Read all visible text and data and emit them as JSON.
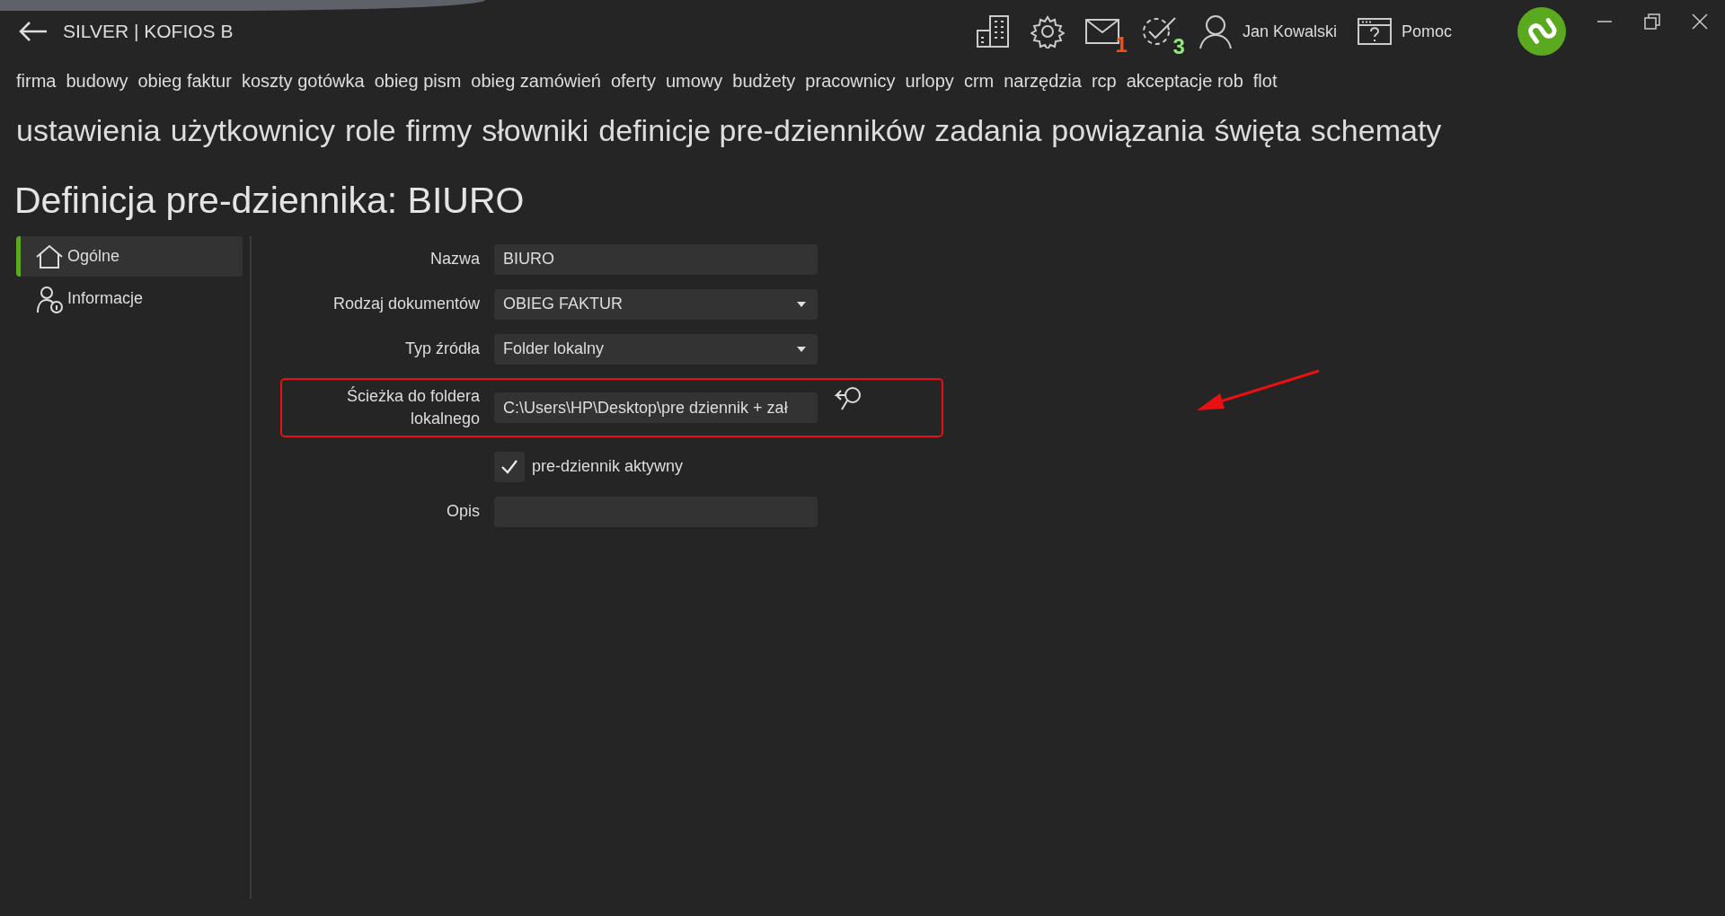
{
  "app_bar": {
    "title": "SILVER | KOFIOS B",
    "user_name": "Jan Kowalski",
    "help_label": "Pomoc",
    "mail_count": "1",
    "task_count": "3"
  },
  "main_menu": [
    "firma",
    "budowy",
    "obieg faktur",
    "koszty gotówka",
    "obieg pism",
    "obieg zamówień",
    "oferty",
    "umowy",
    "budżety",
    "pracownicy",
    "urlopy",
    "crm",
    "narzędzia",
    "rcp",
    "akceptacje rob",
    "flot"
  ],
  "sub_menu": [
    "ustawienia",
    "użytkownicy",
    "role",
    "firmy",
    "słowniki",
    "definicje pre-dzienników",
    "zadania",
    "powiązania",
    "święta",
    "schematy"
  ],
  "page_title": "Definicja pre-dziennika: BIURO",
  "sidebar": {
    "items": [
      {
        "label": "Ogólne",
        "kind": "home",
        "selected": true
      },
      {
        "label": "Informacje",
        "kind": "user-info",
        "selected": false
      }
    ]
  },
  "form": [
    {
      "kind": "text",
      "label": "Nazwa",
      "value": "BIURO"
    },
    {
      "kind": "dropdown",
      "label": "Rodzaj dokumentów",
      "value": "OBIEG FAKTUR"
    },
    {
      "kind": "dropdown",
      "label": "Typ źródła",
      "value": "Folder lokalny"
    },
    {
      "kind": "path",
      "label": "Ścieżka do foldera lokalnego",
      "value": "C:\\Users\\HP\\Desktop\\pre dziennik + zał",
      "highlighted": true
    },
    {
      "kind": "checkbox",
      "label": "pre-dziennik aktywny",
      "checked": true
    },
    {
      "kind": "text",
      "label": "Opis"
    }
  ]
}
